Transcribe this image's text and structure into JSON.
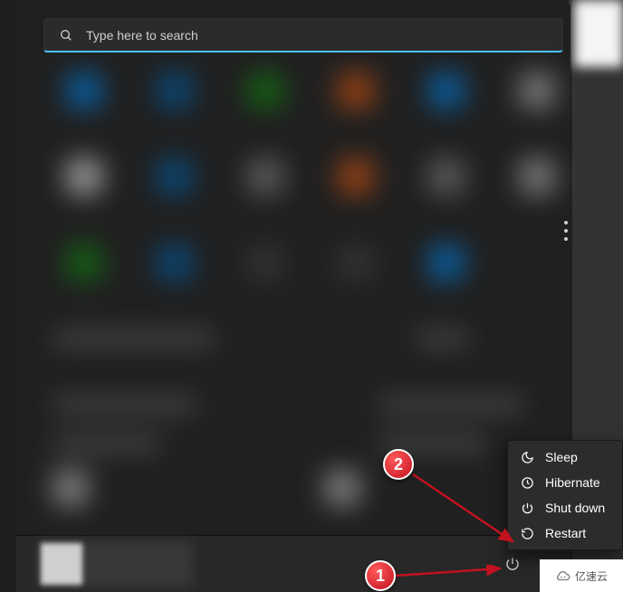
{
  "search": {
    "placeholder": "Type here to search"
  },
  "power_menu": {
    "items": [
      {
        "label": "Sleep",
        "icon": "sleep-icon"
      },
      {
        "label": "Hibernate",
        "icon": "hibernate-icon"
      },
      {
        "label": "Shut down",
        "icon": "shutdown-icon"
      },
      {
        "label": "Restart",
        "icon": "restart-icon"
      }
    ]
  },
  "annotations": {
    "badge1": "1",
    "badge2": "2"
  },
  "watermark": {
    "text": "亿速云"
  },
  "colors": {
    "accent": "#4cc2ff",
    "badge": "#c1121f"
  }
}
